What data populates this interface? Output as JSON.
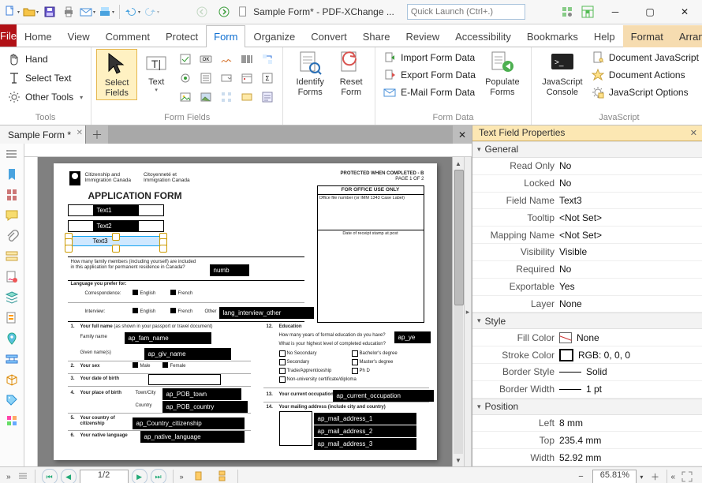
{
  "app": {
    "title": "Sample Form* - PDF-XChange ...",
    "quick_launch_placeholder": "Quick Launch (Ctrl+.)"
  },
  "tabs": {
    "file": "File",
    "list": [
      "Home",
      "View",
      "Comment",
      "Protect",
      "Form",
      "Organize",
      "Convert",
      "Share",
      "Review",
      "Accessibility",
      "Bookmarks",
      "Help"
    ],
    "active": "Form",
    "context": [
      "Format",
      "Arrange"
    ]
  },
  "ribbon": {
    "tools": {
      "label": "Tools",
      "hand": "Hand",
      "select_text": "Select Text",
      "other": "Other Tools"
    },
    "form_fields": {
      "label": "Form Fields",
      "select_fields": "Select Fields",
      "text": "Text"
    },
    "forms": {
      "identify": "Identify Forms",
      "reset": "Reset Form"
    },
    "form_data": {
      "label": "Form Data",
      "import": "Import Form Data",
      "export": "Export Form Data",
      "email": "E-Mail Form Data",
      "populate": "Populate Forms"
    },
    "javascript": {
      "label": "JavaScript",
      "console": "JavaScript Console",
      "doc_js": "Document JavaScript",
      "doc_actions": "Document Actions",
      "js_options": "JavaScript Options"
    }
  },
  "doc_tab": "Sample Form *",
  "page": {
    "flag_lines": [
      "Citizenship and",
      "Immigration Canada",
      "Citoyenneté et",
      "Immigration Canada"
    ],
    "protected": "PROTECTED WHEN COMPLETED - B",
    "page_of": "PAGE 1 OF 2",
    "title": "APPLICATION FORM",
    "office_use": "FOR OFFICE USE ONLY",
    "office_file": "Office file number (or IMM 1343 Case Label)",
    "date_receipt": "Date of receipt stamp at post",
    "text1": "Text1",
    "text2": "Text2",
    "text3": "Text3",
    "q_family": "How many family members (including yourself) are included in this application for permanent residence in Canada?",
    "numb": "numb",
    "lang_prefer": "Language you prefer for:",
    "correspondence": "Correspondence:",
    "interview": "Interview:",
    "english": "English",
    "french": "French",
    "other": "Other",
    "lang_interview_other": "lang_interview_other",
    "full_name_lbl": "Your full name",
    "full_name_note": "(as shown in your passport or travel document)",
    "family_name": "Family name",
    "given_names": "Given name(s)",
    "ap_fam_name": "ap_fam_name",
    "ap_giv_name": "ap_giv_name",
    "your_sex": "Your sex",
    "male": "Male",
    "female": "Female",
    "dob": "Your date of birth",
    "pob": "Your place of birth",
    "town_city": "Town/City",
    "country": "Country",
    "ap_pob_town": "ap_POB_town",
    "ap_pob_country": "ap_POB_country",
    "citizenship": "Your country of citizenship",
    "ap_country_citizenship": "ap_Country_citizenship",
    "native_lang": "Your native language",
    "ap_native_language": "ap_native_language",
    "education_hdr": "Education",
    "edu_q1": "How many years of formal education do you have?",
    "edu_q2": "What is your highest level of completed education?",
    "ap_ye": "ap_ye",
    "secondary": "Secondary",
    "trade": "Trade/Apprenticeship",
    "nonuni": "Non-university certificate/diploma",
    "bachelors": "Bachelor's degree",
    "masters": "Master's degree",
    "phd": "Ph D",
    "no_secondary": "No Secondary",
    "cur_occ": "Your current occupation",
    "ap_current_occupation": "ap_current_occupation",
    "mailing_hdr": "Your mailing address",
    "mailing_note": "(include city and country)",
    "ap_mail_1": "ap_mail_address_1",
    "ap_mail_2": "ap_mail_address_2",
    "ap_mail_3": "ap_mail_address_3",
    "n": {
      "n1": "1.",
      "n2": "2.",
      "n3": "3.",
      "n4": "4.",
      "n5": "5.",
      "n6": "6.",
      "n12": "12.",
      "n13": "13.",
      "n14": "14."
    }
  },
  "props": {
    "title": "Text Field Properties",
    "general": "General",
    "style": "Style",
    "position": "Position",
    "rows": {
      "read_only": {
        "k": "Read Only",
        "v": "No"
      },
      "locked": {
        "k": "Locked",
        "v": "No"
      },
      "field_name": {
        "k": "Field Name",
        "v": "Text3"
      },
      "tooltip": {
        "k": "Tooltip",
        "v": "<Not Set>"
      },
      "mapping_name": {
        "k": "Mapping Name",
        "v": "<Not Set>"
      },
      "visibility": {
        "k": "Visibility",
        "v": "Visible"
      },
      "required": {
        "k": "Required",
        "v": "No"
      },
      "exportable": {
        "k": "Exportable",
        "v": "Yes"
      },
      "layer": {
        "k": "Layer",
        "v": "None"
      },
      "fill_color": {
        "k": "Fill Color",
        "v": "None"
      },
      "stroke_color": {
        "k": "Stroke Color",
        "v": "RGB: 0, 0, 0"
      },
      "border_style": {
        "k": "Border Style",
        "v": "Solid"
      },
      "border_width": {
        "k": "Border Width",
        "v": "1 pt"
      },
      "left": {
        "k": "Left",
        "v": "8 mm"
      },
      "top": {
        "k": "Top",
        "v": "235.4 mm"
      },
      "width": {
        "k": "Width",
        "v": "52.92 mm"
      }
    }
  },
  "status": {
    "page": "1/2",
    "zoom": "65.81%"
  }
}
